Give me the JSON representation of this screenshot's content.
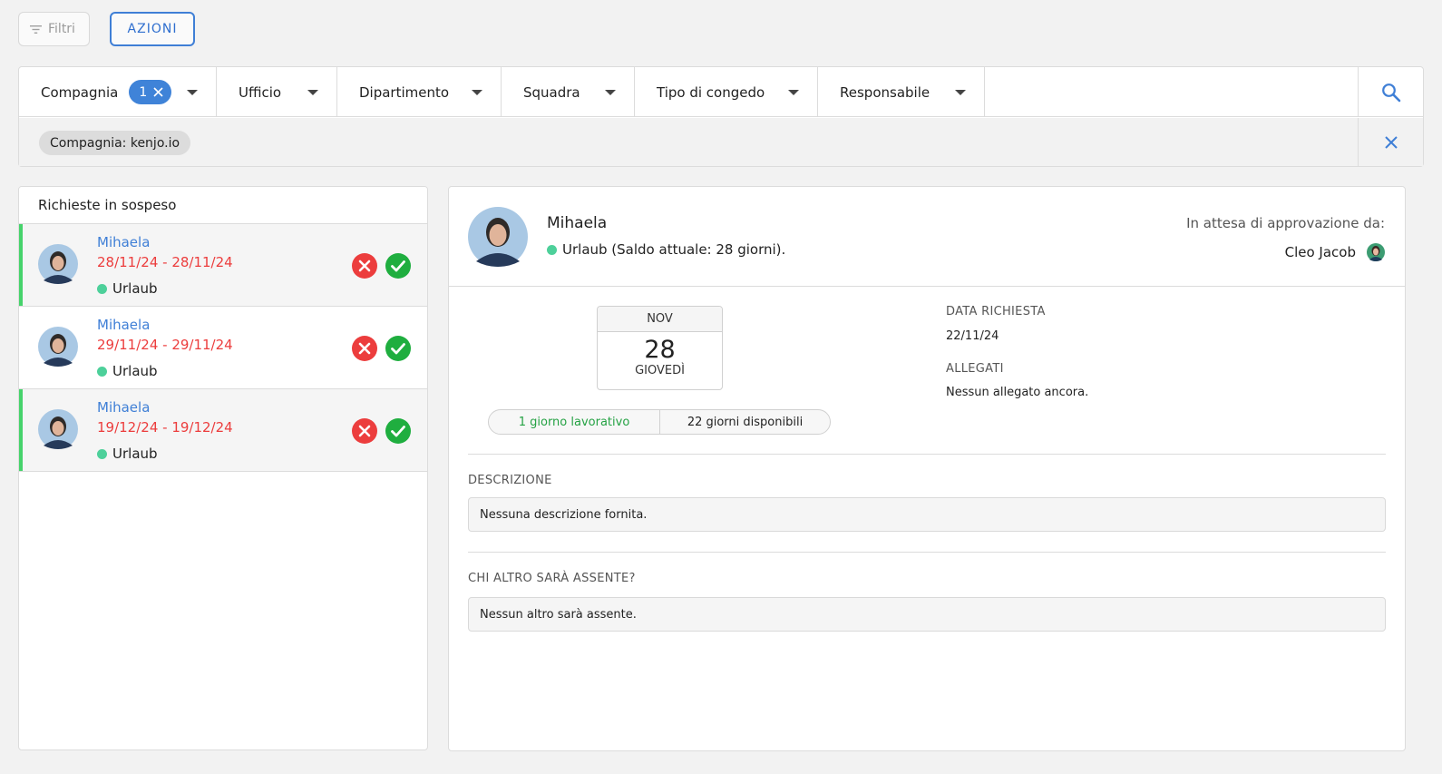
{
  "toolbar": {
    "filters_label": "Filtri",
    "actions_label": "AZIONI"
  },
  "filters": {
    "company_label": "Compagnia",
    "company_count": "1",
    "office_label": "Ufficio",
    "department_label": "Dipartimento",
    "team_label": "Squadra",
    "leave_type_label": "Tipo di congedo",
    "manager_label": "Responsabile",
    "active_chip": "Compagnia: kenjo.io"
  },
  "pending": {
    "title": "Richieste in sospeso",
    "items": [
      {
        "name": "Mihaela",
        "dates": "28/11/24 - 28/11/24",
        "type": "Urlaub",
        "active": true
      },
      {
        "name": "Mihaela",
        "dates": "29/11/24 - 29/11/24",
        "type": "Urlaub",
        "active": false
      },
      {
        "name": "Mihaela",
        "dates": "19/12/24 - 19/12/24",
        "type": "Urlaub",
        "active": true
      }
    ]
  },
  "detail": {
    "name": "Mihaela",
    "subtitle": "Urlaub (Saldo attuale: 28 giorni).",
    "waiting_label": "In attesa di approvazione da:",
    "approver": "Cleo Jacob",
    "calendar": {
      "month": "NOV",
      "day": "28",
      "weekday": "GIOVEDÌ"
    },
    "working_days": "1 giorno lavorativo",
    "available_days": "22 giorni disponibili",
    "request_date_label": "DATA RICHIESTA",
    "request_date": "22/11/24",
    "attachments_label": "ALLEGATI",
    "attachments_value": "Nessun allegato ancora.",
    "description_label": "DESCRIZIONE",
    "description_value": "Nessuna descrizione fornita.",
    "absent_label": "CHI ALTRO SARÀ ASSENTE?",
    "absent_value": "Nessun altro sarà assente."
  },
  "colors": {
    "accent": "#3f7fd6",
    "reject": "#ec3d3d",
    "accept": "#1fae3f",
    "leave_dot": "#4dd09a",
    "active_bar": "#46d36b"
  }
}
